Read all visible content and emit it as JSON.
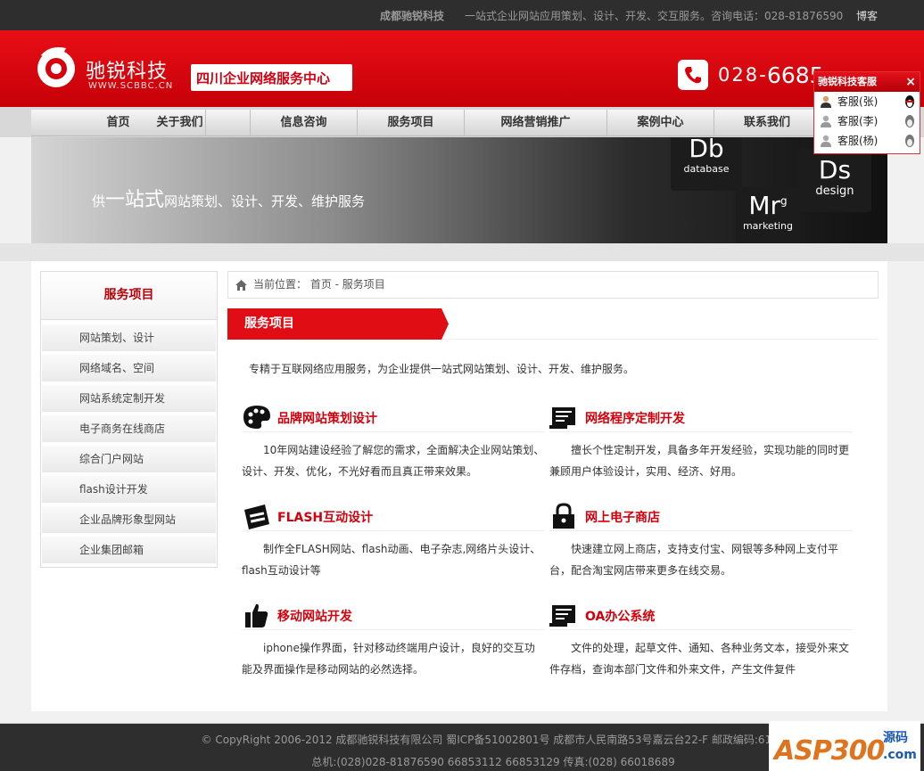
{
  "topbar": {
    "brand": "成都驰锐科技",
    "tagline": "一站式企业网站应用策划、设计、开发、交互服务。咨询电话：028-81876590",
    "blog": "博客"
  },
  "header": {
    "logo_cn": "驰锐科技",
    "logo_en": "WWW.SCBBC.CN",
    "slogan": "四川企业网络服务中心",
    "phone_prefix": "028-",
    "phone_main": "6685"
  },
  "nav": [
    "首页",
    "关于我们",
    "信息咨询",
    "服务项目",
    "网络营销推广",
    "案例中心",
    "联系我们"
  ],
  "banner": {
    "text_prefix": "供",
    "text_big": "一站式",
    "text_suffix": "网站策划、设计、开发、维护服务",
    "tiles": [
      {
        "abbr": "Db",
        "word": "database"
      },
      {
        "abbr": "Ds",
        "word": "design"
      },
      {
        "abbr": "Mr",
        "sup": "g",
        "word": "marketing"
      }
    ]
  },
  "sidebar": {
    "title": "服务项目",
    "items": [
      "网站策划、设计",
      "网络域名、空间",
      "网站系统定制开发",
      "电子商务在线商店",
      "综合门户网站",
      "flash设计开发",
      "企业品牌形象型网站",
      "企业集团邮箱"
    ]
  },
  "content": {
    "crumb_label": "当前位置：",
    "crumb_path": "首页 - 服务项目",
    "section_title": "服务项目",
    "intro": "专精于互联网络应用服务，为企业提供一站式网站策划、设计、开发、维护服务。",
    "services": [
      {
        "icon": "palette-icon",
        "title": "品牌网站策划设计",
        "desc": "10年网站建设经验了解您的需求，全面解决企业网站策划、设计、开发、优化，不光好看而且真正带来效果。"
      },
      {
        "icon": "code-scroll-icon",
        "title": "网络程序定制开发",
        "desc": "擅长个性定制开发，具备多年开发经验，实现功能的同时更兼顾用户体验设计，实用、经济、好用。"
      },
      {
        "icon": "flash-card-icon",
        "title": "FLASH互动设计",
        "desc": "制作全FLASH网站、flash动画、电子杂志,网络片头设计、flash互动设计等"
      },
      {
        "icon": "lock-icon",
        "title": "网上电子商店",
        "desc": "快速建立网上商店，支持支付宝、网银等多种网上支付平台，配合淘宝网店带来更多在线交易。"
      },
      {
        "icon": "thumbs-up-icon",
        "title": "移动网站开发",
        "desc": "iphone操作界面，针对移动终端用户设计，良好的交互功能及界面操作是移动网站的必然选择。"
      },
      {
        "icon": "document-scroll-icon",
        "title": "OA办公系统",
        "desc": "文件的处理，起草文件、通知、各种业务文本，接受外来文件存档，查询本部门文件和外来文件，产生文件复件"
      }
    ]
  },
  "footer": {
    "line1": "© CopyRight 2006-2012 成都驰锐科技有限公司 蜀ICP备51002801号 成都市人民南路53号嘉云台22-F 邮政编码:6100",
    "line2": "总机:(028)028-81876590 66853112 66853129 传真:(028) 66018689"
  },
  "badge": {
    "brand": "ASP300",
    "tag1": "源码",
    "tag2": ".com"
  },
  "cs": {
    "title": "驰锐科技客服",
    "close": "×",
    "agents": [
      "客服(张)",
      "客服(李)",
      "客服(杨)"
    ]
  },
  "colors": {
    "brand_red": "#e00d14",
    "dark_bar": "#2e2e2e",
    "title_red": "#d3000b"
  }
}
